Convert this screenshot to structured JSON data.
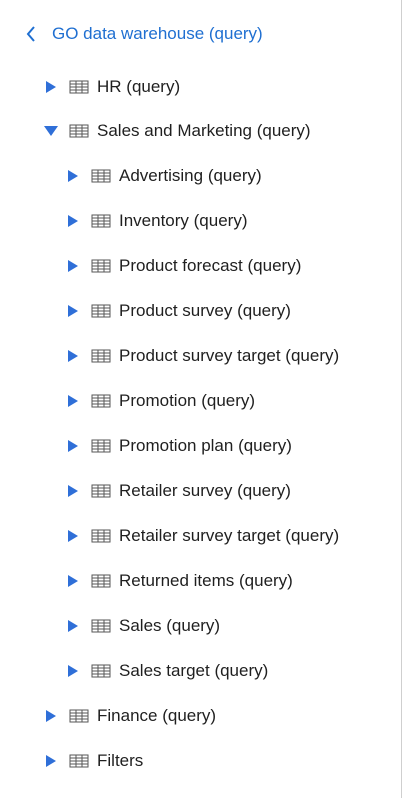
{
  "header": {
    "back_label": "GO data warehouse (query)"
  },
  "tree": {
    "items": [
      {
        "label": "HR (query)",
        "state": "collapsed",
        "level": 0
      },
      {
        "label": "Sales and Marketing (query)",
        "state": "expanded",
        "level": 0,
        "children": [
          {
            "label": "Advertising (query)",
            "state": "collapsed"
          },
          {
            "label": "Inventory (query)",
            "state": "collapsed"
          },
          {
            "label": "Product forecast (query)",
            "state": "collapsed"
          },
          {
            "label": "Product survey (query)",
            "state": "collapsed"
          },
          {
            "label": "Product survey target (query)",
            "state": "collapsed"
          },
          {
            "label": "Promotion (query)",
            "state": "collapsed"
          },
          {
            "label": "Promotion plan (query)",
            "state": "collapsed"
          },
          {
            "label": "Retailer survey (query)",
            "state": "collapsed"
          },
          {
            "label": "Retailer survey target (query)",
            "state": "collapsed"
          },
          {
            "label": "Returned items (query)",
            "state": "collapsed"
          },
          {
            "label": "Sales (query)",
            "state": "collapsed"
          },
          {
            "label": "Sales target (query)",
            "state": "collapsed"
          }
        ]
      },
      {
        "label": "Finance (query)",
        "state": "collapsed",
        "level": 0
      },
      {
        "label": "Filters",
        "state": "collapsed",
        "level": 0
      }
    ]
  },
  "icons": {
    "toggle_collapsed": "caret-right-icon",
    "toggle_expanded": "caret-down-icon",
    "table": "table-icon",
    "back": "chevron-left-icon"
  },
  "colors": {
    "accent": "#1f6fd1",
    "toggle": "#2f6fd8",
    "text": "#1f1f1f",
    "divider": "#cfcfcf"
  }
}
